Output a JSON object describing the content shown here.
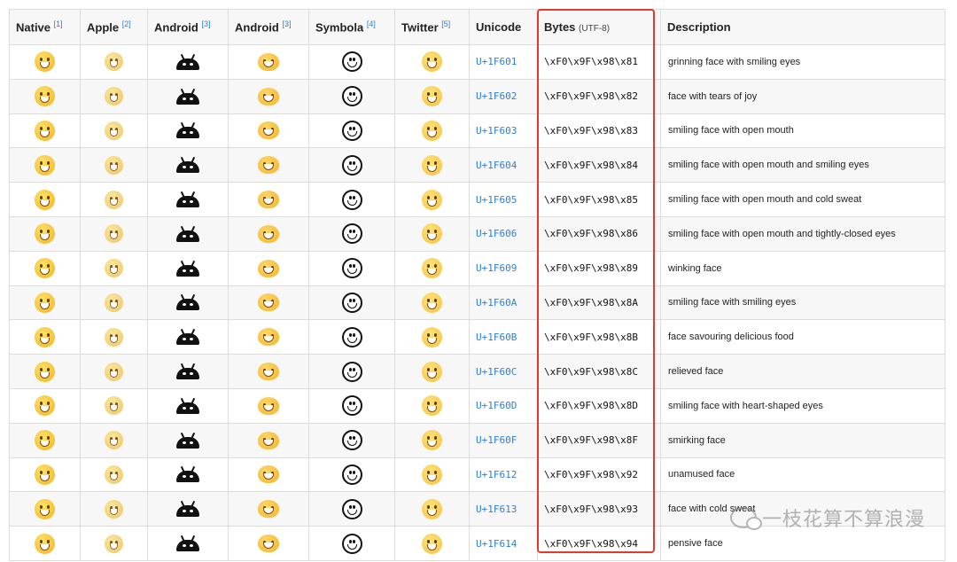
{
  "headers": {
    "native": "Native",
    "native_ref": "[1]",
    "apple": "Apple",
    "apple_ref": "[2]",
    "android1": "Android",
    "android1_ref": "[3]",
    "android2": "Android",
    "android2_ref": "[3]",
    "symbola": "Symbola",
    "symbola_ref": "[4]",
    "twitter": "Twitter",
    "twitter_ref": "[5]",
    "unicode": "Unicode",
    "bytes": "Bytes",
    "bytes_note": "(UTF-8)",
    "description": "Description"
  },
  "rows": [
    {
      "unicode": "U+1F601",
      "bytes": "\\xF0\\x9F\\x98\\x81",
      "description": "grinning face with smiling eyes"
    },
    {
      "unicode": "U+1F602",
      "bytes": "\\xF0\\x9F\\x98\\x82",
      "description": "face with tears of joy"
    },
    {
      "unicode": "U+1F603",
      "bytes": "\\xF0\\x9F\\x98\\x83",
      "description": "smiling face with open mouth"
    },
    {
      "unicode": "U+1F604",
      "bytes": "\\xF0\\x9F\\x98\\x84",
      "description": "smiling face with open mouth and smiling eyes"
    },
    {
      "unicode": "U+1F605",
      "bytes": "\\xF0\\x9F\\x98\\x85",
      "description": "smiling face with open mouth and cold sweat"
    },
    {
      "unicode": "U+1F606",
      "bytes": "\\xF0\\x9F\\x98\\x86",
      "description": "smiling face with open mouth and tightly-closed eyes"
    },
    {
      "unicode": "U+1F609",
      "bytes": "\\xF0\\x9F\\x98\\x89",
      "description": "winking face"
    },
    {
      "unicode": "U+1F60A",
      "bytes": "\\xF0\\x9F\\x98\\x8A",
      "description": "smiling face with smiling eyes"
    },
    {
      "unicode": "U+1F60B",
      "bytes": "\\xF0\\x9F\\x98\\x8B",
      "description": "face savouring delicious food"
    },
    {
      "unicode": "U+1F60C",
      "bytes": "\\xF0\\x9F\\x98\\x8C",
      "description": "relieved face"
    },
    {
      "unicode": "U+1F60D",
      "bytes": "\\xF0\\x9F\\x98\\x8D",
      "description": "smiling face with heart-shaped eyes"
    },
    {
      "unicode": "U+1F60F",
      "bytes": "\\xF0\\x9F\\x98\\x8F",
      "description": "smirking face"
    },
    {
      "unicode": "U+1F612",
      "bytes": "\\xF0\\x9F\\x98\\x92",
      "description": "unamused face"
    },
    {
      "unicode": "U+1F613",
      "bytes": "\\xF0\\x9F\\x98\\x93",
      "description": "face with cold sweat"
    },
    {
      "unicode": "U+1F614",
      "bytes": "\\xF0\\x9F\\x98\\x94",
      "description": "pensive face"
    }
  ],
  "watermark": "一枝花算不算浪漫",
  "colors": {
    "link": "#2e7dd6",
    "highlight": "#e23a2e",
    "header_bg": "#f7f7f7",
    "stripe": "#f7f7f7"
  }
}
